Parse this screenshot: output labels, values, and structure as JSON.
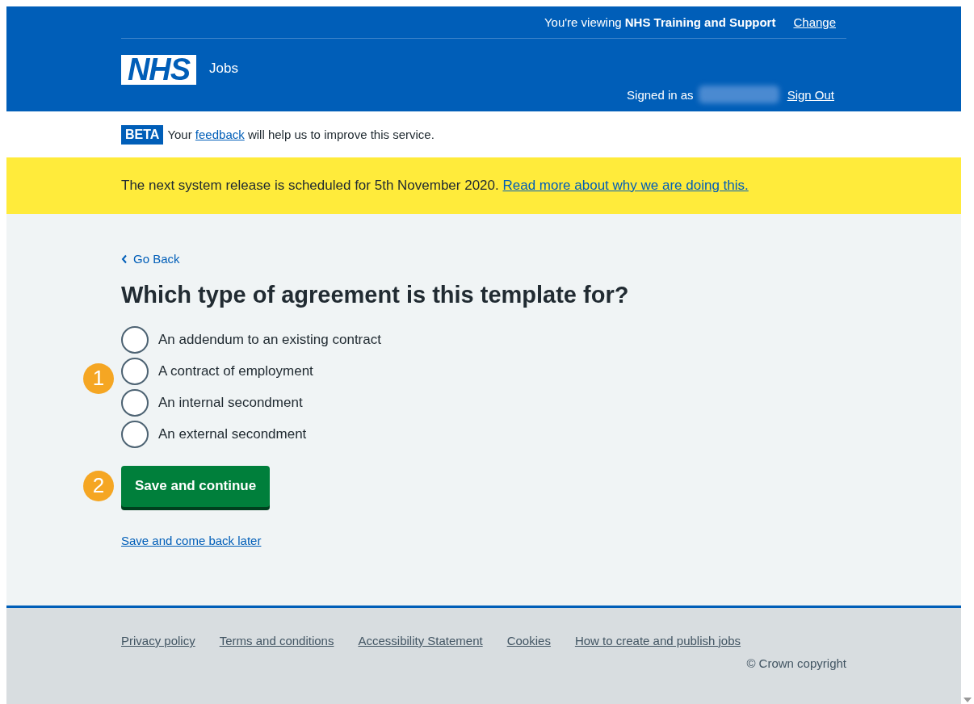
{
  "header": {
    "viewing_prefix": "You're viewing",
    "organisation": "NHS Training and Support",
    "change_link": "Change",
    "logo": "NHS",
    "service_name": "Jobs",
    "signed_in_label": "Signed in as",
    "sign_out_link": "Sign Out"
  },
  "phase_banner": {
    "tag": "BETA",
    "text_before": "Your",
    "link": "feedback",
    "text_after": "will help us to improve this service."
  },
  "notice": {
    "text": "The next system release is scheduled for 5th November 2020.",
    "link": "Read more about why we are doing this."
  },
  "back_link": "Go Back",
  "question": "Which type of agreement is this template for?",
  "options": [
    {
      "label": "An addendum to an existing contract",
      "selected": false
    },
    {
      "label": "A contract of employment",
      "selected": false
    },
    {
      "label": "An internal secondment",
      "selected": false
    },
    {
      "label": "An external secondment",
      "selected": false
    }
  ],
  "callouts": [
    "1",
    "2"
  ],
  "primary_button": "Save and continue",
  "secondary_link": "Save and come back later",
  "footer": {
    "links": [
      "Privacy policy",
      "Terms and conditions",
      "Accessibility Statement",
      "Cookies",
      "How to create and publish jobs"
    ],
    "copyright": "© Crown copyright"
  }
}
